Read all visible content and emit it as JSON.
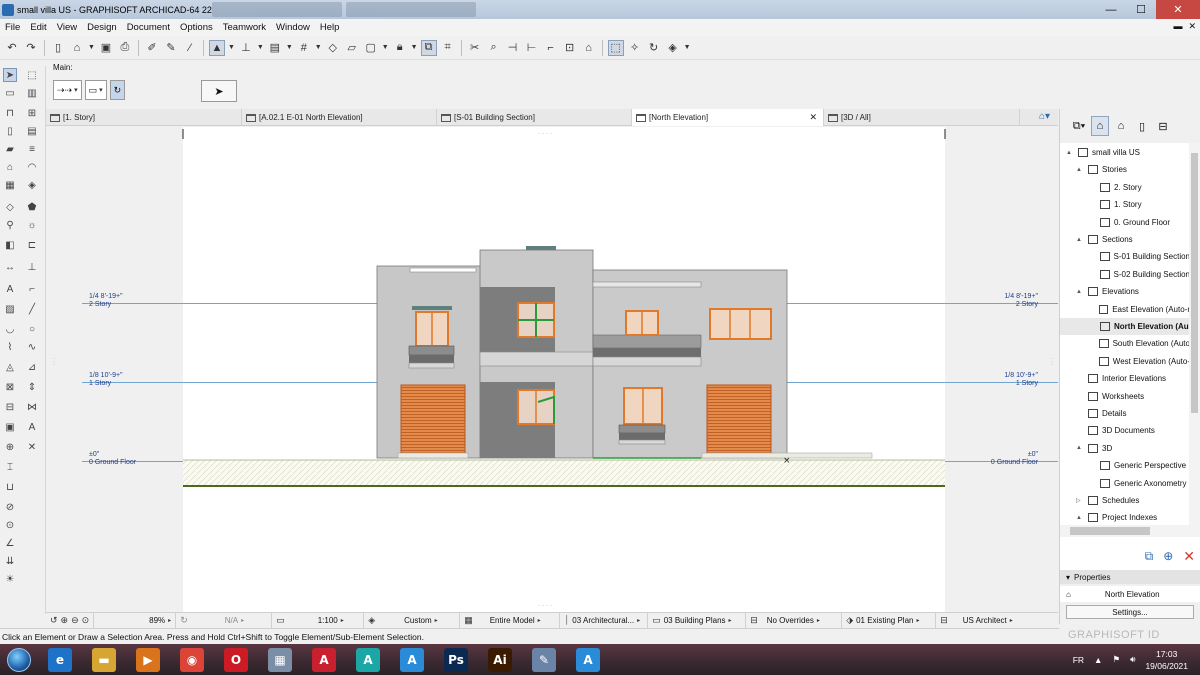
{
  "window": {
    "title": "small villa US - GRAPHISOFT ARCHICAD-64 22"
  },
  "menu": [
    "File",
    "Edit",
    "View",
    "Design",
    "Document",
    "Options",
    "Teamwork",
    "Window",
    "Help"
  ],
  "infobox": {
    "main_label": "Main:"
  },
  "tabs": [
    {
      "label": "[1. Story]",
      "active": false
    },
    {
      "label": "[A.02.1 E-01 North Elevation]",
      "active": false
    },
    {
      "label": "[S-01 Building Section]",
      "active": false
    },
    {
      "label": "[North Elevation]",
      "active": true
    },
    {
      "label": "[3D / All]",
      "active": false
    }
  ],
  "levels": [
    {
      "elev": "1/4 8'-19+\"",
      "name": "2 Story"
    },
    {
      "elev": "1/8 10'-9+\"",
      "name": "1 Story"
    },
    {
      "elev": "±0\"",
      "name": "0 Ground Floor"
    }
  ],
  "navigator": {
    "tree": [
      {
        "label": "small villa US",
        "icon": "project-icon",
        "expander": "▲",
        "selected": false
      },
      {
        "label": "Stories",
        "icon": "stories-icon",
        "expander": "▲",
        "selected": false
      },
      {
        "label": "2. Story",
        "icon": "story-icon",
        "expander": "",
        "selected": false
      },
      {
        "label": "1. Story",
        "icon": "story-icon",
        "expander": "",
        "selected": false
      },
      {
        "label": "0. Ground Floor",
        "icon": "story-icon",
        "expander": "",
        "selected": false
      },
      {
        "label": "Sections",
        "icon": "section-icon",
        "expander": "▲",
        "selected": false
      },
      {
        "label": "S-01 Building Section",
        "icon": "section-icon",
        "expander": "",
        "selected": false
      },
      {
        "label": "S-02 Building Section",
        "icon": "section-icon",
        "expander": "",
        "selected": false
      },
      {
        "label": "Elevations",
        "icon": "elevation-icon",
        "expander": "▲",
        "selected": false
      },
      {
        "label": "East Elevation (Auto-r",
        "icon": "elevation-icon",
        "expander": "",
        "selected": false
      },
      {
        "label": "North Elevation (Au",
        "icon": "elevation-icon",
        "expander": "",
        "selected": true
      },
      {
        "label": "South Elevation (Auto",
        "icon": "elevation-icon",
        "expander": "",
        "selected": false
      },
      {
        "label": "West Elevation (Auto-",
        "icon": "elevation-icon",
        "expander": "",
        "selected": false
      },
      {
        "label": "Interior Elevations",
        "icon": "interior-elevation-icon",
        "expander": "",
        "selected": false
      },
      {
        "label": "Worksheets",
        "icon": "worksheet-icon",
        "expander": "",
        "selected": false
      },
      {
        "label": "Details",
        "icon": "detail-icon",
        "expander": "",
        "selected": false
      },
      {
        "label": "3D Documents",
        "icon": "3d-document-icon",
        "expander": "",
        "selected": false
      },
      {
        "label": "3D",
        "icon": "3d-icon",
        "expander": "▲",
        "selected": false
      },
      {
        "label": "Generic Perspective",
        "icon": "perspective-icon",
        "expander": "",
        "selected": false
      },
      {
        "label": "Generic Axonometry",
        "icon": "axonometry-icon",
        "expander": "",
        "selected": false
      },
      {
        "label": "Schedules",
        "icon": "schedule-icon",
        "expander": "▷",
        "selected": false
      },
      {
        "label": "Project Indexes",
        "icon": "index-icon",
        "expander": "▲",
        "selected": false
      }
    ]
  },
  "properties": {
    "header": "Properties",
    "view_name": "North Elevation",
    "settings_label": "Settings..."
  },
  "quick_options": {
    "zoom": "89%",
    "rotation": "N/A",
    "scale": "1:100",
    "layer_combo": "Custom",
    "model_view": "Entire Model",
    "pen_set": "03 Architectural...",
    "mvo": "03 Building Plans",
    "graphic_override": "No Overrides",
    "renovation_filter": "01 Existing Plan",
    "dimension": "US Architect"
  },
  "status": {
    "message": "Click an Element or Draw a Selection Area. Press and Hold Ctrl+Shift to Toggle Element/Sub-Element Selection."
  },
  "branding": {
    "graphisoft": "GRAPHISOFT ID"
  },
  "taskbar": {
    "apps": [
      {
        "name": "internet-explorer-icon",
        "glyph": "e",
        "color": "#1e73c8"
      },
      {
        "name": "file-explorer-icon",
        "glyph": "▬",
        "color": "#d7a531"
      },
      {
        "name": "media-player-icon",
        "glyph": "▶",
        "color": "#d9731c"
      },
      {
        "name": "chrome-icon",
        "glyph": "◉",
        "color": "#db4437"
      },
      {
        "name": "opera-icon",
        "glyph": "O",
        "color": "#cc1b24"
      },
      {
        "name": "calculator-icon",
        "glyph": "▦",
        "color": "#7a8ea6"
      },
      {
        "name": "autocad-icon",
        "glyph": "A",
        "color": "#c8202f"
      },
      {
        "name": "autocad-lt-icon",
        "glyph": "A",
        "color": "#1ca6a6"
      },
      {
        "name": "revit-icon",
        "glyph": "A",
        "color": "#2a8bd8"
      },
      {
        "name": "photoshop-icon",
        "glyph": "Ps",
        "color": "#0b2a52"
      },
      {
        "name": "illustrator-icon",
        "glyph": "Ai",
        "color": "#3a1b02"
      },
      {
        "name": "paint-icon",
        "glyph": "✎",
        "color": "#6c83a8"
      },
      {
        "name": "archicad-icon",
        "glyph": "A",
        "color": "#2a8bd8"
      }
    ],
    "lang": "FR",
    "time": "17:03",
    "date": "19/06/2021"
  },
  "colors": {
    "accent": "#2b6cb0",
    "story_line": "#6fa5d0",
    "window_frame": "#e07a2a",
    "ground_line": "#4a6b1e"
  }
}
